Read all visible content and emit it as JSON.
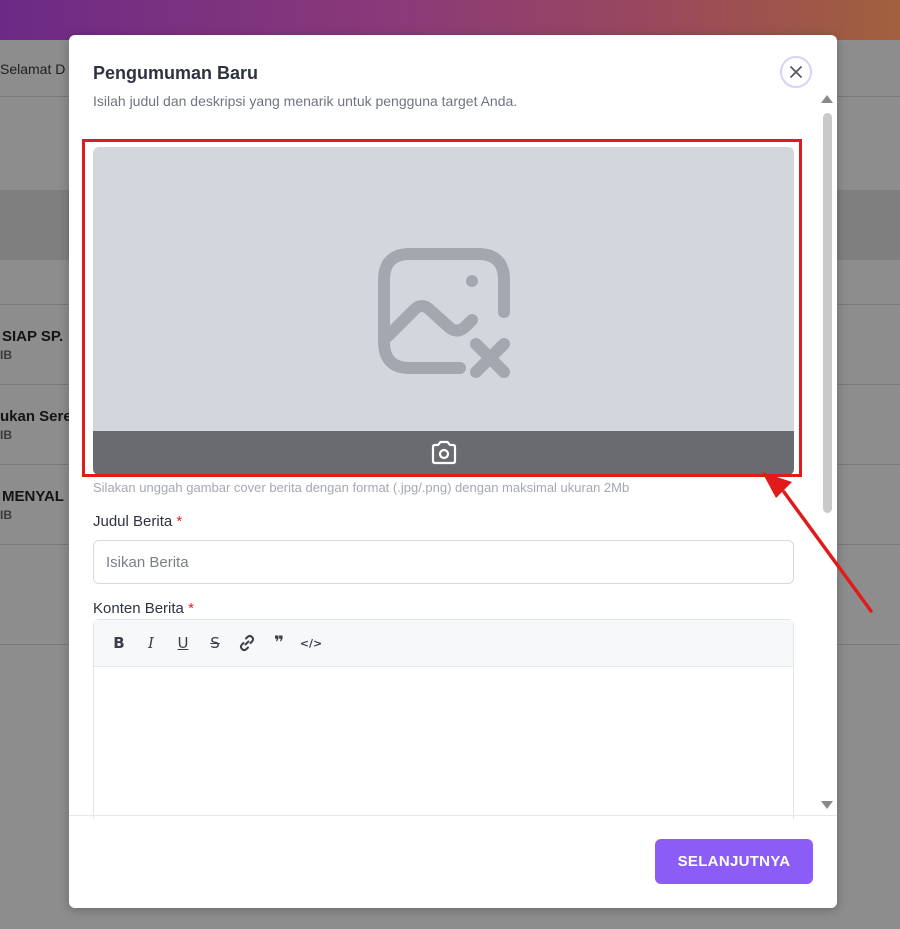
{
  "background": {
    "greeting": "Selamat D",
    "rows": [
      {
        "title": "SIAP SP.",
        "sub": "IB"
      },
      {
        "title": "ukan Sere",
        "sub": "IB"
      },
      {
        "title": "MENYAL",
        "sub": "IB"
      }
    ]
  },
  "modal": {
    "title": "Pengumuman Baru",
    "subtitle": "Isilah judul dan deskripsi yang menarik untuk pengguna target Anda.",
    "close_icon": "close-icon"
  },
  "upload": {
    "placeholder_icon": "image-remove-icon",
    "camera_icon": "camera-icon",
    "hint": "Silakan unggah gambar cover berita dengan format (.jpg/.png) dengan maksimal ukuran 2Mb"
  },
  "form": {
    "title_label": "Judul Berita",
    "title_required": "*",
    "title_placeholder": "Isikan Berita",
    "content_label": "Konten Berita",
    "content_required": "*",
    "toolbar": {
      "bold": "B",
      "italic": "I",
      "underline": "U",
      "strike": "S",
      "link_icon": "link-icon",
      "quote": "❞",
      "code": "</>"
    }
  },
  "footer": {
    "next_label": "SELANJUTNYA"
  },
  "colors": {
    "accent": "#8b5cf6",
    "highlight": "#e01b1b"
  }
}
